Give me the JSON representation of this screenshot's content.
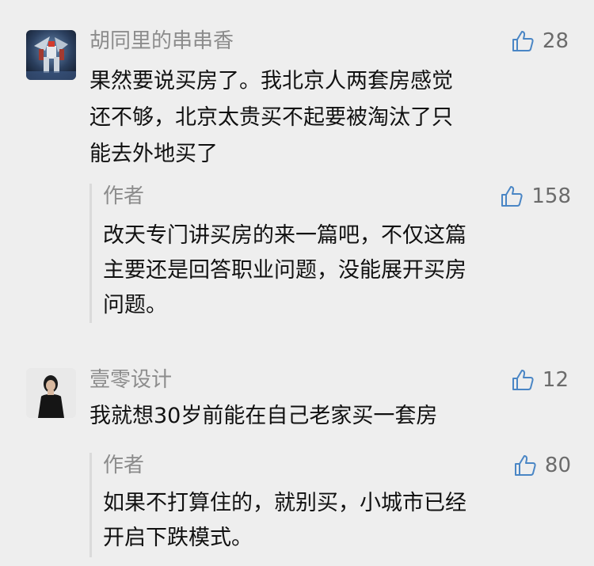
{
  "comments": [
    {
      "nickname": "胡同里的串串香",
      "likes": "28",
      "text_lines": [
        "果然要说买房了。我北京人两套房感觉",
        "还不够，北京太贵买不起要被淘汰了只",
        "能去外地买了"
      ],
      "reply": {
        "author": "作者",
        "likes": "158",
        "text_lines": [
          "改天专门讲买房的来一篇吧，不仅这篇",
          "主要还是回答职业问题，没能展开买房",
          "问题。"
        ]
      }
    },
    {
      "nickname": "壹零设计",
      "likes": "12",
      "text_lines": [
        "我就想30岁前能在自己老家买一套房"
      ],
      "reply": {
        "author": "作者",
        "likes": "80",
        "text_lines": [
          "如果不打算住的，就别买，小城市已经",
          "开启下跌模式。"
        ]
      }
    }
  ],
  "icons": {
    "like": "thumbs-up-outline-icon"
  },
  "colors": {
    "background": "#eeeeee",
    "secondary_text": "#8c8c8c",
    "reply_border": "#dadada"
  }
}
